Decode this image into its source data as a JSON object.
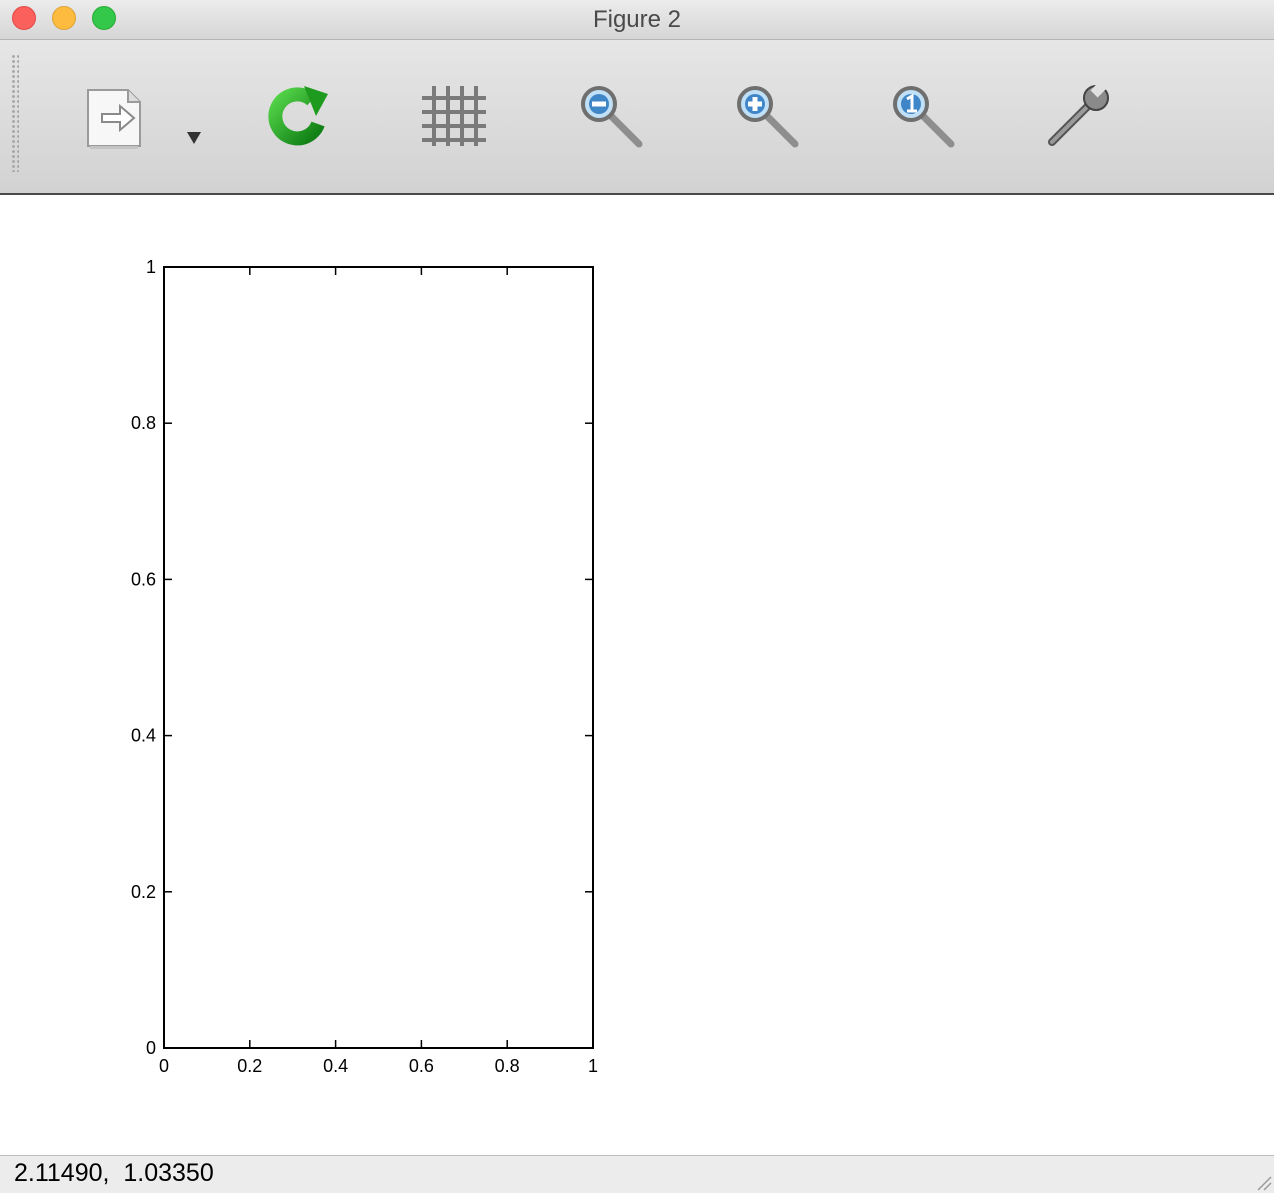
{
  "window": {
    "title": "Figure 2"
  },
  "toolbar": {
    "buttons": [
      {
        "icon": "export-document-icon"
      },
      {
        "icon": "dropdown-arrow-icon"
      },
      {
        "icon": "refresh-icon",
        "color": "#1e9b1e"
      },
      {
        "icon": "grid-icon"
      },
      {
        "icon": "zoom-out-icon"
      },
      {
        "icon": "zoom-in-icon"
      },
      {
        "icon": "zoom-reset-icon"
      },
      {
        "icon": "wrench-icon"
      }
    ]
  },
  "chart_data": {
    "type": "line",
    "series": [],
    "xlim": [
      0,
      1
    ],
    "ylim": [
      0,
      1
    ],
    "x_ticks": [
      "0",
      "0.2",
      "0.4",
      "0.6",
      "0.8",
      "1"
    ],
    "y_ticks": [
      "0",
      "0.2",
      "0.4",
      "0.6",
      "0.8",
      "1"
    ],
    "grid": false
  },
  "status": {
    "coordinates": "2.11490,  1.03350"
  }
}
